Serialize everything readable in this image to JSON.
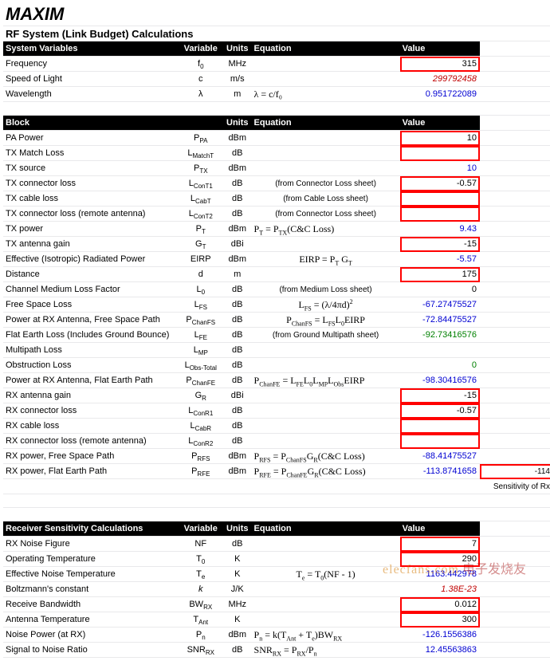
{
  "brand": "MAXIM",
  "title": "RF System (Link Budget) Calculations",
  "headers": {
    "sysvar": "System Variables",
    "variable": "Variable",
    "units": "Units",
    "equation": "Equation",
    "value": "Value",
    "block": "Block",
    "receiver": "Receiver Sensitivity Calculations"
  },
  "sysvars": [
    {
      "label": "Frequency",
      "var": "f",
      "sub": "0",
      "units": "MHz",
      "eq": "",
      "value": "315",
      "cls": "",
      "box": true
    },
    {
      "label": "Speed of Light",
      "var": "c",
      "sub": "",
      "units": "m/s",
      "eq": "",
      "value": "299792458",
      "cls": "redtxt",
      "box": false
    },
    {
      "label": "Wavelength",
      "var": "λ",
      "sub": "",
      "units": "m",
      "eq": "λ = c/f₀",
      "value": "0.951722089",
      "cls": "blue",
      "box": false
    }
  ],
  "block": [
    {
      "label": "PA Power",
      "var": "P",
      "sub": "PA",
      "units": "dBm",
      "eq": "",
      "value": "10",
      "cls": "",
      "box": true
    },
    {
      "label": "TX Match Loss",
      "var": "L",
      "sub": "MatchT",
      "units": "dB",
      "eq": "",
      "value": "",
      "cls": "",
      "box": true
    },
    {
      "label": "TX source",
      "var": "P",
      "sub": "TX",
      "units": "dBm",
      "eq": "",
      "value": "10",
      "cls": "blue",
      "box": false
    },
    {
      "label": "TX connector loss",
      "var": "L",
      "sub": "ConT1",
      "units": "dB",
      "eqnote": "(from Connector Loss sheet)",
      "value": "-0.57",
      "cls": "",
      "box": true
    },
    {
      "label": "TX cable loss",
      "var": "L",
      "sub": "CabT",
      "units": "dB",
      "eqnote": "(from Cable Loss sheet)",
      "value": "",
      "cls": "",
      "box": true
    },
    {
      "label": "TX connector loss (remote antenna)",
      "var": "L",
      "sub": "ConT2",
      "units": "dB",
      "eqnote": "(from Connector Loss sheet)",
      "value": "",
      "cls": "",
      "box": true
    },
    {
      "label": "TX power",
      "var": "P",
      "sub": "T",
      "units": "dBm",
      "eq": "P<sub>T</sub> = P<sub>TX</sub>(C&C Loss)",
      "value": "9.43",
      "cls": "blue",
      "box": false
    },
    {
      "label": "TX antenna gain",
      "var": "G",
      "sub": "T",
      "units": "dBi",
      "eq": "",
      "value": "-15",
      "cls": "",
      "box": true
    },
    {
      "label": "Effective (Isotropic) Radiated Power",
      "var": "EIRP",
      "sub": "",
      "units": "dBm",
      "eq": "EIRP = P<sub>T</sub> G<sub>T</sub>",
      "eqcenter": true,
      "value": "-5.57",
      "cls": "blue",
      "box": false
    },
    {
      "label": "Distance",
      "var": "d",
      "sub": "",
      "units": "m",
      "eq": "",
      "value": "175",
      "cls": "",
      "box": true
    },
    {
      "label": "Channel Medium Loss Factor",
      "var": "L",
      "sub": "0",
      "units": "dB",
      "eqnote": "(from Medium Loss sheet)",
      "value": "0",
      "cls": "",
      "box": false
    },
    {
      "label": "Free Space Loss",
      "var": "L",
      "sub": "FS",
      "units": "dB",
      "eq": "L<sub>FS</sub> = (λ/4πd)<sup>2</sup>",
      "eqcenter": true,
      "value": "-67.27475527",
      "cls": "blue",
      "box": false
    },
    {
      "label": "Power at RX Antenna, Free Space Path",
      "var": "P",
      "sub": "ChanFS",
      "units": "dB",
      "eq": "P<sub>ChanFS</sub> = L<sub>FS</sub>L<sub>0</sub>EIRP",
      "eqcenter": true,
      "value": "-72.84475527",
      "cls": "blue",
      "box": false
    },
    {
      "label": "Flat Earth Loss (Includes Ground Bounce)",
      "var": "L",
      "sub": "FE",
      "units": "dB",
      "eqnote": "(from Ground Multipath sheet)",
      "value": "-92.73416576",
      "cls": "green",
      "box": false
    },
    {
      "label": "Multipath Loss",
      "var": "L",
      "sub": "MP",
      "units": "dB",
      "eq": "",
      "value": "",
      "cls": "",
      "box": false
    },
    {
      "label": "Obstruction Loss",
      "var": "L",
      "sub": "Obs-Total",
      "units": "dB",
      "eq": "",
      "value": "0",
      "cls": "green",
      "box": false
    },
    {
      "label": "Power at RX Antenna, Flat Earth Path",
      "var": "P",
      "sub": "ChanFE",
      "units": "dB",
      "eq": "P<sub>ChanFE</sub> = L<sub>FE</sub>L<sub>0</sub>L<sub>MP</sub>L<sub>Obs</sub>EIRP",
      "value": "-98.30416576",
      "cls": "blue",
      "box": false
    },
    {
      "label": "RX antenna gain",
      "var": "G",
      "sub": "R",
      "units": "dBi",
      "eq": "",
      "value": "-15",
      "cls": "",
      "box": true
    },
    {
      "label": "RX connector loss",
      "var": "L",
      "sub": "ConR1",
      "units": "dB",
      "eq": "",
      "value": "-0.57",
      "cls": "",
      "box": true
    },
    {
      "label": "RX cable loss",
      "var": "L",
      "sub": "CabR",
      "units": "dB",
      "eq": "",
      "value": "",
      "cls": "",
      "box": true
    },
    {
      "label": "RX connector loss (remote antenna)",
      "var": "L",
      "sub": "ConR2",
      "units": "dB",
      "eq": "",
      "value": "",
      "cls": "",
      "box": true
    },
    {
      "label": "RX power, Free Space Path",
      "var": "P",
      "sub": "RFS",
      "units": "dBm",
      "eq": "P<sub>RFS</sub> = P<sub>ChanFS</sub>G<sub>R</sub>(C&C Loss)",
      "value": "-88.41475527",
      "cls": "blue",
      "box": false
    },
    {
      "label": "RX power, Flat Earth Path",
      "var": "P",
      "sub": "RFE",
      "units": "dBm",
      "eq": "P<sub>RFE</sub> = P<sub>ChanFE</sub>G<sub>R</sub>(C&C Loss)",
      "value": "-113.8741658",
      "cls": "blue",
      "box": false,
      "extra": "-114",
      "extralabel": "Sensitivity of Rx"
    }
  ],
  "receiver": [
    {
      "label": "RX Noise Figure",
      "var": "NF",
      "sub": "",
      "units": "dB",
      "eq": "",
      "value": "7",
      "cls": "",
      "box": true
    },
    {
      "label": "Operating Temperature",
      "var": "T",
      "sub": "0",
      "units": "K",
      "eq": "",
      "value": "290",
      "cls": "",
      "box": true
    },
    {
      "label": "Effective Noise Temperature",
      "var": "T",
      "sub": "e",
      "units": "K",
      "eq": "T<sub>e</sub> = T<sub>0</sub>(NF - 1)",
      "eqcenter": true,
      "value": "1163.442978",
      "cls": "blue",
      "box": false
    },
    {
      "label": "Boltzmann's constant",
      "var": "k",
      "sub": "",
      "units": "J/K",
      "eq": "",
      "value": "1.38E-23",
      "cls": "redtxt",
      "box": false,
      "varItalic": true
    },
    {
      "label": "Receive Bandwidth",
      "var": "BW",
      "sub": "RX",
      "units": "MHz",
      "eq": "",
      "value": "0.012",
      "cls": "",
      "box": true
    },
    {
      "label": "Antenna Temperature",
      "var": "T",
      "sub": "Ant",
      "units": "K",
      "eq": "",
      "value": "300",
      "cls": "",
      "box": true
    },
    {
      "label": "Noise Power (at RX)",
      "var": "P",
      "sub": "n",
      "units": "dBm",
      "eq": "P<sub>n</sub> = k(T<sub>Ant</sub> + T<sub>e</sub>)BW<sub>RX</sub>",
      "value": "-126.1556386",
      "cls": "blue",
      "box": false
    },
    {
      "label": "Signal to Noise Ratio",
      "var": "SNR",
      "sub": "RX",
      "units": "dB",
      "eq": "SNR<sub>RX</sub> = P<sub>RX</sub>/P<sub>n</sub>",
      "value": "12.45563863",
      "cls": "blue",
      "box": false
    }
  ],
  "watermark": {
    "text1": "elecfans.com",
    "text2": "电子发烧友"
  }
}
